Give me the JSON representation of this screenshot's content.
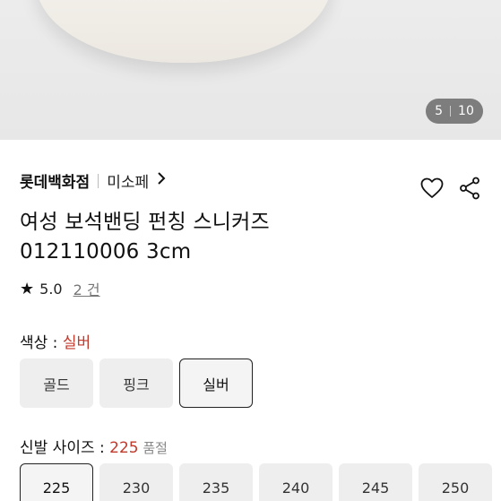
{
  "gallery": {
    "current": "5",
    "total": "10"
  },
  "breadcrumb": {
    "brand": "롯데백화점",
    "sub_brand": "미소페"
  },
  "product": {
    "name": "여성 보석밴딩 펀칭 스니커즈",
    "code": "012110006 3cm"
  },
  "rating": {
    "score": "5.0",
    "reviews": "2 건"
  },
  "color_option": {
    "label": "색상 : ",
    "selected": "실버",
    "choices": [
      "골드",
      "핑크",
      "실버"
    ],
    "selected_index": 2
  },
  "size_option": {
    "label": "신발 사이즈 : ",
    "selected": "225",
    "stock_note": " 품절",
    "choices": [
      "225",
      "230",
      "235",
      "240",
      "245",
      "250"
    ],
    "selected_index": 0
  },
  "icons": {
    "wishlist": "heart-icon",
    "share": "share-icon",
    "rating": "star-icon",
    "breadcrumb": "chevron-right-icon"
  },
  "colors": {
    "accent": "#c0392b",
    "chip_bg": "#eeeeee",
    "selected_border": "#222222"
  }
}
